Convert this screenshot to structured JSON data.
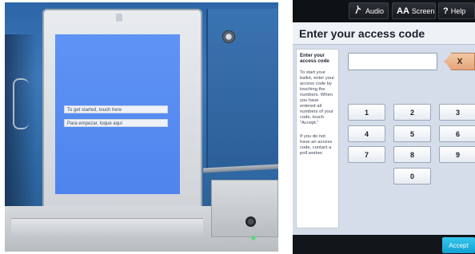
{
  "photo": {
    "screen_buttons": {
      "english": "To get started, touch here",
      "spanish": "Para empezar, toque aquí"
    }
  },
  "kiosk": {
    "toolbar": {
      "audio": {
        "icon": "audio-icon",
        "label": "Audio"
      },
      "screen": {
        "icon": "text-size-icon",
        "icon_text": "AA",
        "label": "Screen"
      },
      "help": {
        "icon": "help-icon",
        "icon_text": "?",
        "label": "Help"
      }
    },
    "title": "Enter your access code",
    "sidebar": {
      "heading": "Enter your access code",
      "instructions": "To start your ballot, enter your access code by touching the numbers. When you have entered all numbers of your code, touch \"Accept.\"",
      "help_text": "If you do not have an access code, contact a poll worker."
    },
    "code_field": {
      "value": ""
    },
    "clear_label": "X",
    "keypad": [
      "1",
      "2",
      "3",
      "4",
      "5",
      "6",
      "7",
      "8",
      "9",
      "0"
    ],
    "accept_label": "Accept"
  }
}
